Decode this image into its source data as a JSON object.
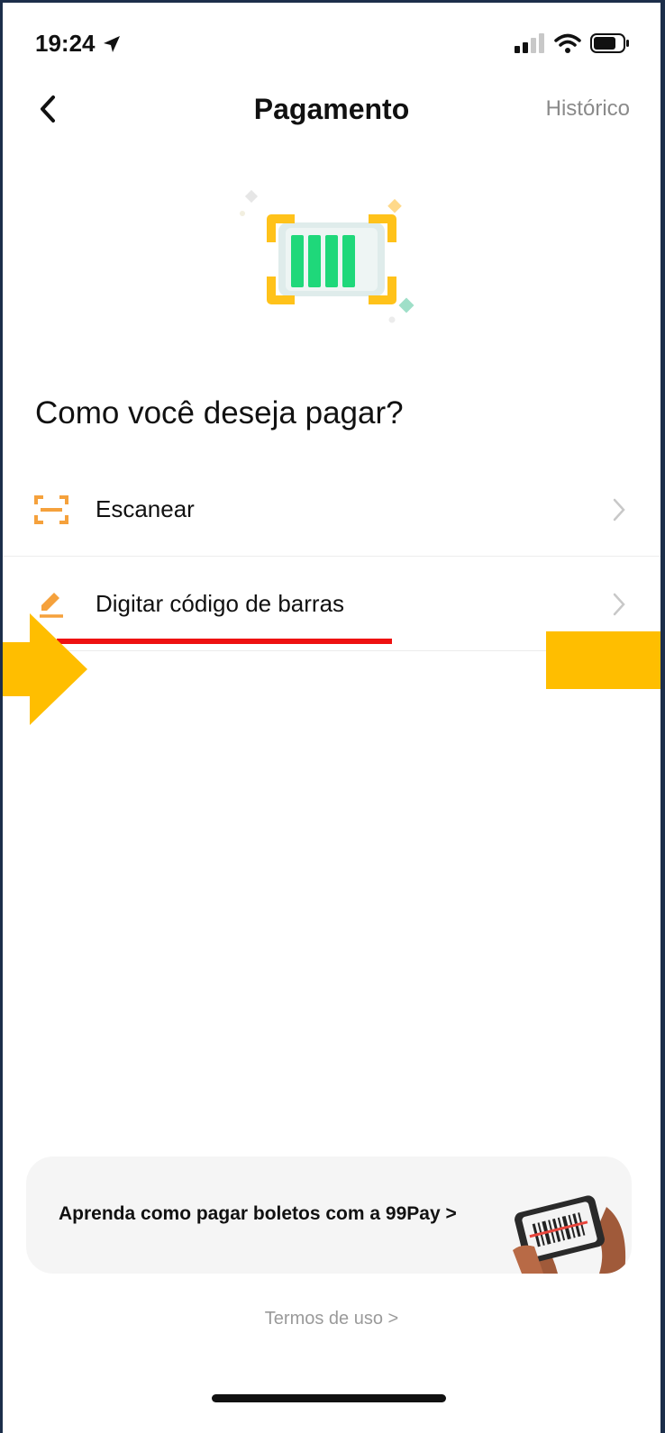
{
  "status_bar": {
    "time": "19:24"
  },
  "nav": {
    "title": "Pagamento",
    "history_label": "Histórico"
  },
  "main": {
    "question": "Como você deseja pagar?",
    "options": [
      {
        "label": "Escanear",
        "icon": "scan-icon"
      },
      {
        "label": "Digitar código de barras",
        "icon": "pencil-icon"
      }
    ]
  },
  "banner": {
    "text": "Aprenda como pagar boletos com a 99Pay >"
  },
  "footer": {
    "terms_label": "Termos de uso >"
  },
  "colors": {
    "accent_orange": "#f5a13c",
    "annotation_red": "#ee1111",
    "annotation_yellow": "#ffbe00",
    "barcode_green": "#1fd87a"
  }
}
